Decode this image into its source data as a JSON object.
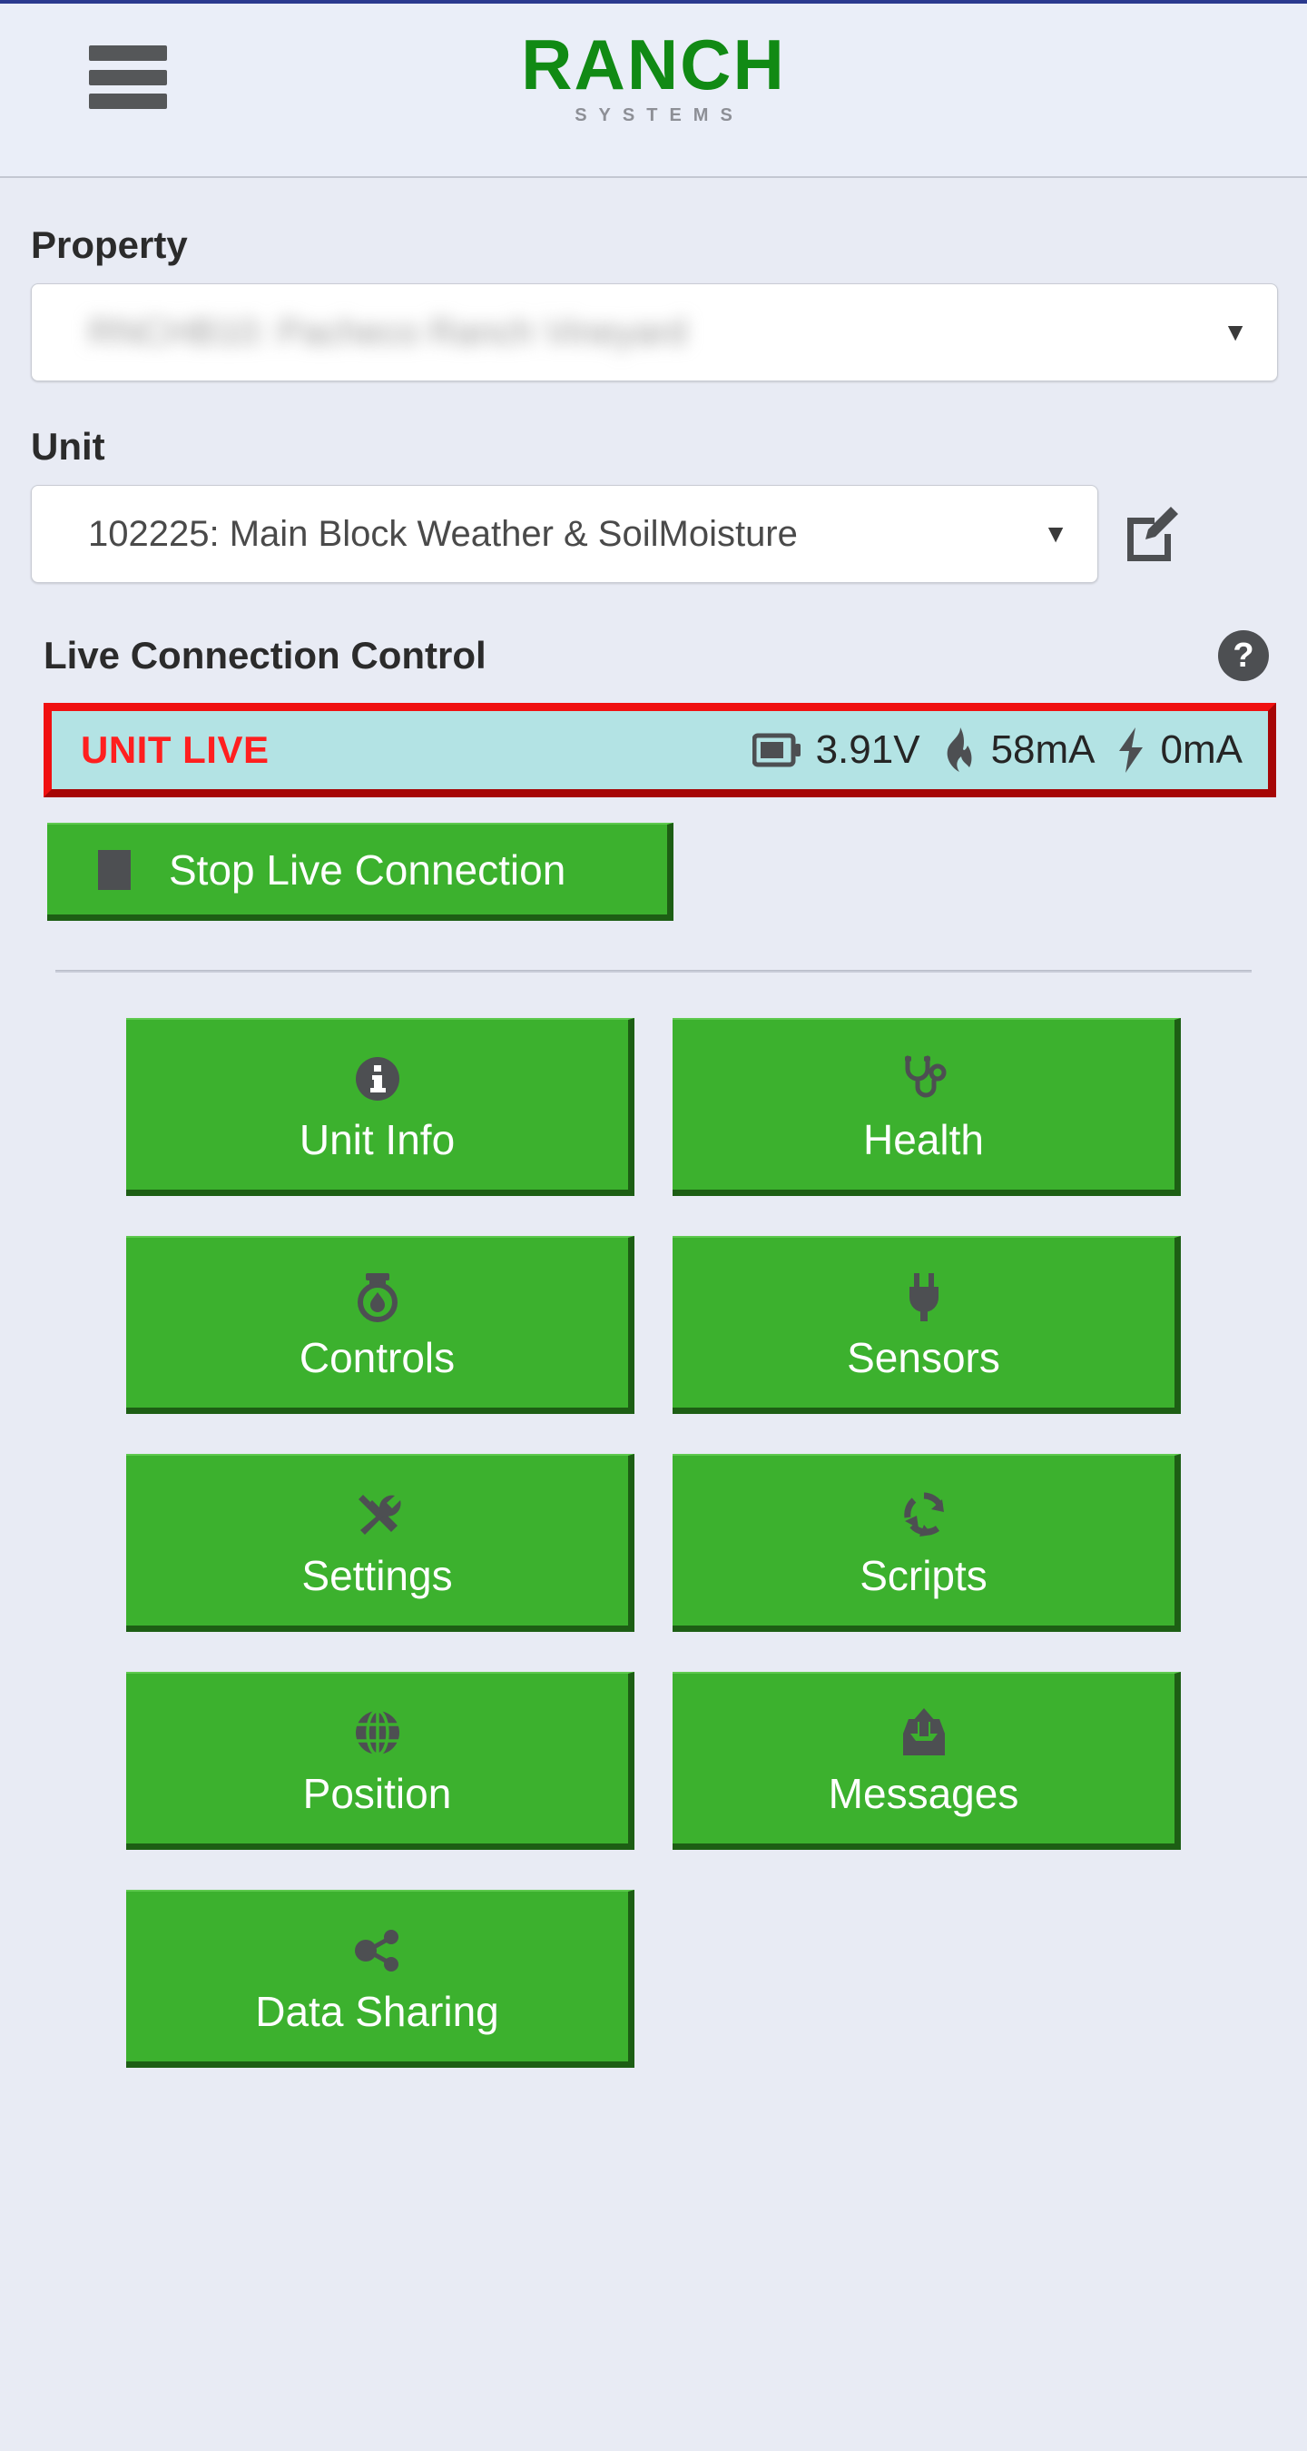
{
  "header": {
    "menu_icon": "hamburger-menu-icon",
    "logo_main": "RANCH",
    "logo_sub": "SYSTEMS"
  },
  "property": {
    "label": "Property",
    "selected": "RNCHB10: Pacheco Ranch Vineyard",
    "redacted": true,
    "caret": "▼"
  },
  "unit": {
    "label": "Unit",
    "selected": "102225: Main Block Weather & SoilMoisture",
    "caret": "▼",
    "edit_icon": "edit-pencil-icon"
  },
  "live_connection": {
    "section_title": "Live Connection Control",
    "help_icon": "?",
    "status_label": "UNIT LIVE",
    "status_text_color": "#ff1f1f",
    "status_bg_color": "#b3e3e4",
    "status_border_color": "#d40808",
    "metrics": [
      {
        "icon": "battery-icon",
        "value": "3.91V"
      },
      {
        "icon": "flame-icon",
        "value": "58mA"
      },
      {
        "icon": "lightning-bolt-icon",
        "value": "0mA"
      }
    ],
    "stop_button_label": "Stop Live Connection",
    "stop_button_icon": "stop-square-icon"
  },
  "menu_grid": {
    "accent_color": "#3cb12e",
    "shadow_color": "#1d5e14",
    "items": [
      {
        "label": "Unit Info",
        "icon": "info-circle-icon"
      },
      {
        "label": "Health",
        "icon": "stethoscope-icon"
      },
      {
        "label": "Controls",
        "icon": "valve-water-drop-icon"
      },
      {
        "label": "Sensors",
        "icon": "power-plug-icon"
      },
      {
        "label": "Settings",
        "icon": "wrench-screwdriver-icon"
      },
      {
        "label": "Scripts",
        "icon": "refresh-cycle-icon"
      },
      {
        "label": "Position",
        "icon": "globe-icon"
      },
      {
        "label": "Messages",
        "icon": "outbox-upload-icon"
      },
      {
        "label": "Data Sharing",
        "icon": "share-nodes-icon"
      }
    ]
  }
}
